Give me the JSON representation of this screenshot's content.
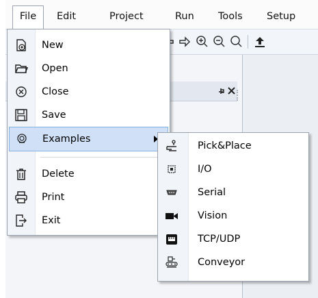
{
  "menubar": {
    "items": [
      "File",
      "Edit",
      "Project",
      "Run",
      "Tools",
      "Setup"
    ]
  },
  "file_menu": {
    "items": [
      {
        "label": "New",
        "icon": "new-file-icon"
      },
      {
        "label": "Open",
        "icon": "open-folder-icon"
      },
      {
        "label": "Close",
        "icon": "close-circle-icon"
      },
      {
        "label": "Save",
        "icon": "save-icon"
      },
      {
        "label": "Examples",
        "icon": "examples-icon",
        "highlighted": true,
        "has_submenu": true
      },
      {
        "label": "Delete",
        "icon": "trash-icon"
      },
      {
        "label": "Print",
        "icon": "printer-icon"
      },
      {
        "label": "Exit",
        "icon": "exit-icon"
      }
    ]
  },
  "examples_submenu": {
    "items": [
      {
        "label": "Pick&Place",
        "icon": "pick-place-icon"
      },
      {
        "label": "I/O",
        "icon": "io-icon"
      },
      {
        "label": "Serial",
        "icon": "serial-icon"
      },
      {
        "label": "Vision",
        "icon": "camera-icon"
      },
      {
        "label": "TCP/UDP",
        "icon": "network-icon"
      },
      {
        "label": "Conveyor",
        "icon": "conveyor-icon"
      }
    ]
  },
  "colors": {
    "highlight_bg": "#cfe0f7",
    "highlight_border": "#86aede",
    "background": "#e9eff7"
  }
}
